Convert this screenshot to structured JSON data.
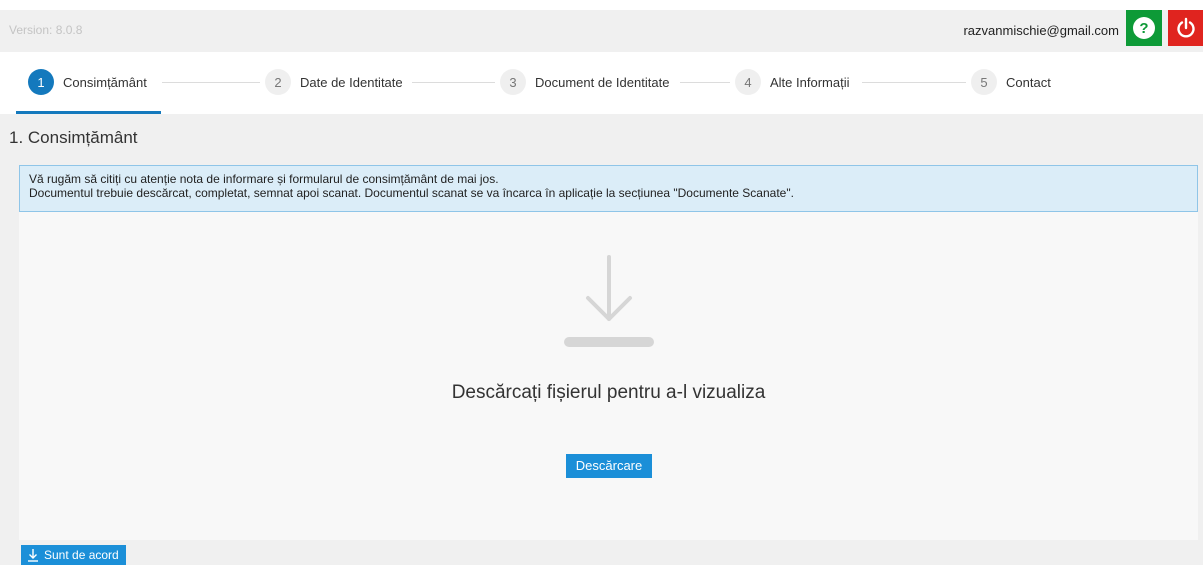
{
  "header": {
    "version": "Version: 8.0.8",
    "user_email": "razvanmischie@gmail.com",
    "help_icon": "question-icon",
    "power_icon": "power-icon",
    "help_color": "#0d9a37",
    "power_color": "#e0241f"
  },
  "steps": [
    {
      "num": "1",
      "label": "Consimțământ",
      "active": true
    },
    {
      "num": "2",
      "label": "Date de Identitate",
      "active": false
    },
    {
      "num": "3",
      "label": "Document de Identitate",
      "active": false
    },
    {
      "num": "4",
      "label": "Alte Informații",
      "active": false
    },
    {
      "num": "5",
      "label": "Contact",
      "active": false
    }
  ],
  "page": {
    "title": "1. Consimțământ",
    "info_line1": "Vă rugăm să citiți cu atenție nota de informare și formularul de consimțământ de mai jos.",
    "info_line2": "Documentul trebuie descărcat, completat, semnat apoi scanat. Documentul scanat se va încarca în aplicație la secțiunea \"Documente Scanate\"."
  },
  "viewer": {
    "icon": "download-icon",
    "message": "Descărcați fișierul pentru a-l vizualiza",
    "download_label": "Descărcare"
  },
  "footer": {
    "agree_label": "Sunt de acord",
    "agree_icon": "download-icon"
  },
  "colors": {
    "accent": "#1479bd",
    "button": "#1b8fd8",
    "info_bg": "#dbedf8"
  }
}
